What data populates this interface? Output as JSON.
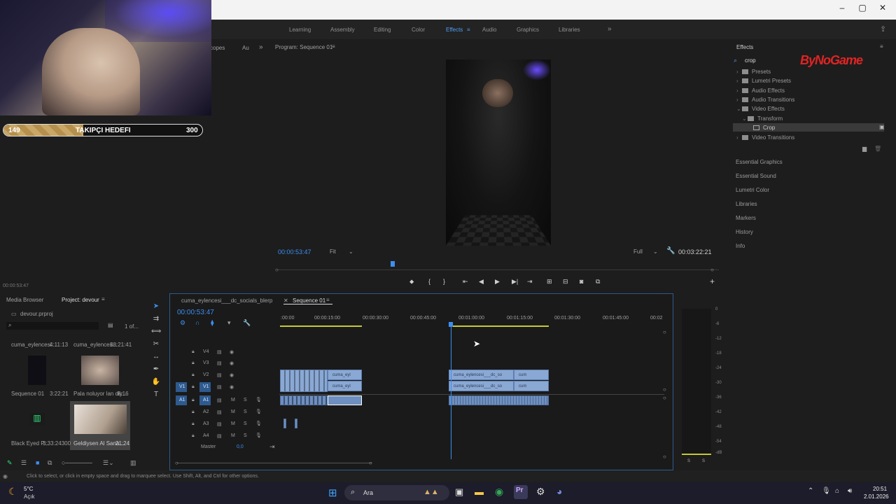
{
  "workspaces": [
    "Learning",
    "Assembly",
    "Editing",
    "Color",
    "Effects",
    "Audio",
    "Graphics",
    "Libraries"
  ],
  "active_workspace": "Effects",
  "overlay": {
    "goal_start": "149",
    "goal_label": "TAKIPÇI HEDEFI",
    "goal_end": "300",
    "goal_progress": 0.4,
    "brand": "ByNoGame"
  },
  "source_panel": {
    "tabs": [
      "copes",
      "Au"
    ],
    "timecode": "00:00:53:47"
  },
  "program": {
    "title": "Program: Sequence 01",
    "timecode": "00:00:53:47",
    "fit": "Fit",
    "quality": "Full",
    "duration": "00:03:22:21"
  },
  "effects": {
    "title": "Effects",
    "search": "crop",
    "tree": [
      "Presets",
      "Lumetri Presets",
      "Audio Effects",
      "Audio Transitions",
      "Video Effects",
      "Transform",
      "Crop",
      "Video Transitions"
    ],
    "side_panels": [
      "Essential Graphics",
      "Essential Sound",
      "Lumetri Color",
      "Libraries",
      "Markers",
      "History",
      "Info"
    ]
  },
  "project": {
    "tabs": [
      "Media Browser",
      "Project: devour"
    ],
    "file": "devour.prproj",
    "count": "1 of...",
    "items": [
      {
        "name": "cuma_eylencesi...",
        "dur": "4:11:13"
      },
      {
        "name": "cuma_eylences...",
        "dur": "38:21:41"
      },
      {
        "name": "Sequence 01",
        "dur": "3:22:21"
      },
      {
        "name": "Pala noluyor lan diy...",
        "dur": "8:16"
      },
      {
        "name": "Black Eyed P...",
        "dur": "3:33:24300"
      },
      {
        "name": "Geldiysen Al Sana...",
        "dur": "21:24"
      }
    ]
  },
  "timeline": {
    "tabs": [
      "cuma_eylencesi___dc_socials_blerp",
      "Sequence 01"
    ],
    "timecode": "00:00:53:47",
    "ruler": [
      ":00:00",
      "00:00:15:00",
      "00:00:30:00",
      "00:00:45:00",
      "00:01:00:00",
      "00:01:15:00",
      "00:01:30:00",
      "00:01:45:00",
      "00:02"
    ],
    "video_tracks": [
      "V4",
      "V3",
      "V2",
      "V1"
    ],
    "audio_tracks": [
      "A1",
      "A2",
      "A3",
      "A4"
    ],
    "master": "Master",
    "master_val": "0,0",
    "clip_labels": [
      "cuma_eyl",
      "cuma_eylencesi___dc_so",
      "cum"
    ],
    "mute": "M",
    "solo": "S"
  },
  "meter_db": [
    "0",
    "-6",
    "-12",
    "-18",
    "-24",
    "-30",
    "-36",
    "-42",
    "-48",
    "-54",
    "-dB"
  ],
  "meter_solo": [
    "S",
    "S"
  ],
  "status": "Click to select, or click in empty space and drag to marquee select. Use Shift, Alt, and Ctrl for other options.",
  "taskbar": {
    "weather": "5°C",
    "weather_desc": "Açık",
    "search": "Ara",
    "time": "20:51",
    "date": "2.01.2026"
  }
}
